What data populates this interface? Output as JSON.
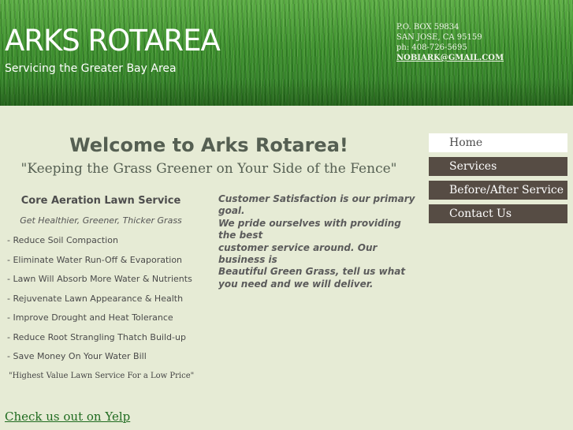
{
  "header": {
    "title": "ARKS ROTAREA",
    "tagline": "Servicing the Greater Bay Area",
    "contact": {
      "po_box": "P.O. BOX 59834",
      "city": "SAN JOSE, CA 95159",
      "phone": "ph: 408-726-5695",
      "email": "NOBIARK@GMAIL.COM"
    }
  },
  "main": {
    "heading": "Welcome to Arks Rotarea!",
    "subtitle": "\"Keeping the Grass Greener on Your Side of the Fence\""
  },
  "service": {
    "title": "Core Aeration Lawn Service",
    "subtitle": "Get Healthier, Greener, Thicker Grass",
    "benefits": [
      "- Reduce Soil Compaction",
      "- Eliminate Water Run-Off & Evaporation",
      "- Lawn Will Absorb More Water & Nutrients",
      "- Rejuvenate Lawn Appearance & Health",
      "- Improve Drought and Heat Tolerance",
      "- Reduce Root Strangling Thatch Build-up",
      "- Save Money On Your Water Bill"
    ],
    "quote": "\"Highest Value Lawn Service For a Low Price\""
  },
  "satisfaction": {
    "lines": [
      "Customer Satisfaction is our primary goal.",
      "We pride ourselves with providing the best",
      "customer service around. Our business is",
      "Beautiful Green Grass, tell us what you need and we will deliver."
    ]
  },
  "yelp": {
    "label": "Check us out on Yelp "
  },
  "nav": {
    "items": [
      {
        "label": "Home",
        "active": true
      },
      {
        "label": "Services",
        "active": false
      },
      {
        "label": "Before/After Service",
        "active": false
      },
      {
        "label": "Contact Us",
        "active": false
      }
    ]
  },
  "colors": {
    "page_background": "#e6ebd5",
    "nav_background": "#564c44",
    "nav_active": "#ffffff",
    "heading": "#555f52",
    "link": "#1f6b1f"
  }
}
